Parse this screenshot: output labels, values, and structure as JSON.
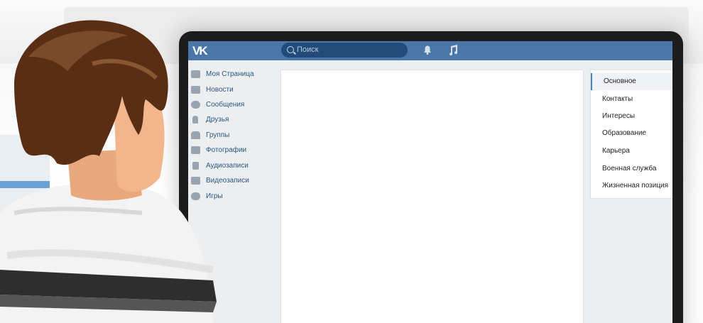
{
  "header": {
    "logo": "VK",
    "search_placeholder": "Поиск"
  },
  "sidebar": {
    "items": [
      {
        "label": "Моя Страница",
        "icon": "home-icon"
      },
      {
        "label": "Новости",
        "icon": "news-icon"
      },
      {
        "label": "Сообщения",
        "icon": "messages-icon"
      },
      {
        "label": "Друзья",
        "icon": "friends-icon"
      },
      {
        "label": "Группы",
        "icon": "groups-icon"
      },
      {
        "label": "Фотографии",
        "icon": "camera-icon"
      },
      {
        "label": "Аудиозаписи",
        "icon": "music-note-icon"
      },
      {
        "label": "Видеозаписи",
        "icon": "film-icon"
      },
      {
        "label": "Игры",
        "icon": "gamepad-icon"
      }
    ]
  },
  "settings_menu": {
    "items": [
      "Основное",
      "Контакты",
      "Интересы",
      "Образование",
      "Карьера",
      "Военная служба",
      "Жизненная позиция"
    ],
    "active_index": 0
  },
  "colors": {
    "header": "#4a76a8",
    "link": "#2a5885",
    "accent": "#5181b8"
  }
}
